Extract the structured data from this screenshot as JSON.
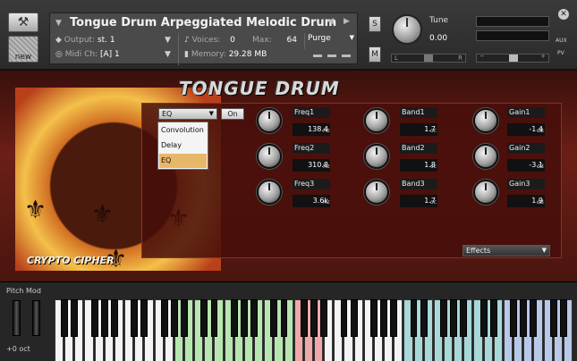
{
  "header": {
    "instrument_title": "Tongue Drum Arpeggiated Melodic Drum",
    "new_label": "new",
    "output_label": "Output:",
    "output_value": "st. 1",
    "voices_label": "Voices:",
    "voices_value": "0",
    "max_label": "Max:",
    "max_value": "64",
    "purge_label": "Purge",
    "midi_label": "Midi Ch:",
    "midi_value": "[A]  1",
    "memory_label": "Memory:",
    "memory_value": "29.28 MB",
    "solo_label": "S",
    "mute_label": "M",
    "tune_label": "Tune",
    "tune_value": "0.00",
    "pan_left": "L",
    "pan_right": "R",
    "aux_label": "AUX",
    "pv_label": "PV"
  },
  "instrument": {
    "logo_text": "TONGUE DRUM",
    "brand_text": "CRYPTO CIPHER"
  },
  "fx": {
    "selected": "EQ",
    "on_label": "On",
    "menu_options": [
      "Convolution",
      "Delay",
      "EQ"
    ],
    "active_option": "EQ",
    "effects_dropdown": "Effects",
    "params": [
      {
        "label": "Freq1",
        "value": "138.4",
        "unit": "Hz"
      },
      {
        "label": "Freq2",
        "value": "310.8",
        "unit": "Hz"
      },
      {
        "label": "Freq3",
        "value": "3.6k",
        "unit": "Hz"
      },
      {
        "label": "Band1",
        "value": "1.7",
        "unit": "oc"
      },
      {
        "label": "Band2",
        "value": "1.8",
        "unit": "oc"
      },
      {
        "label": "Band3",
        "value": "1.7",
        "unit": "oc"
      },
      {
        "label": "Gain1",
        "value": "-1.4",
        "unit": "dB"
      },
      {
        "label": "Gain2",
        "value": "-3.1",
        "unit": "dB"
      },
      {
        "label": "Gain3",
        "value": "1.9",
        "unit": "dB"
      }
    ]
  },
  "keyboard": {
    "pitch_mod_label": "Pitch Mod",
    "octave_label": "+0 oct",
    "colors": {
      "green": "#b8e6b0",
      "pink": "#f0a8a8",
      "teal": "#a8d8d8",
      "blue": "#b8c8e8",
      "white": "#f4f4f4",
      "black": "#111111"
    }
  },
  "icons": {
    "wrench": "wrench-icon",
    "close": "close-icon",
    "caret": "chevron-down-icon"
  }
}
